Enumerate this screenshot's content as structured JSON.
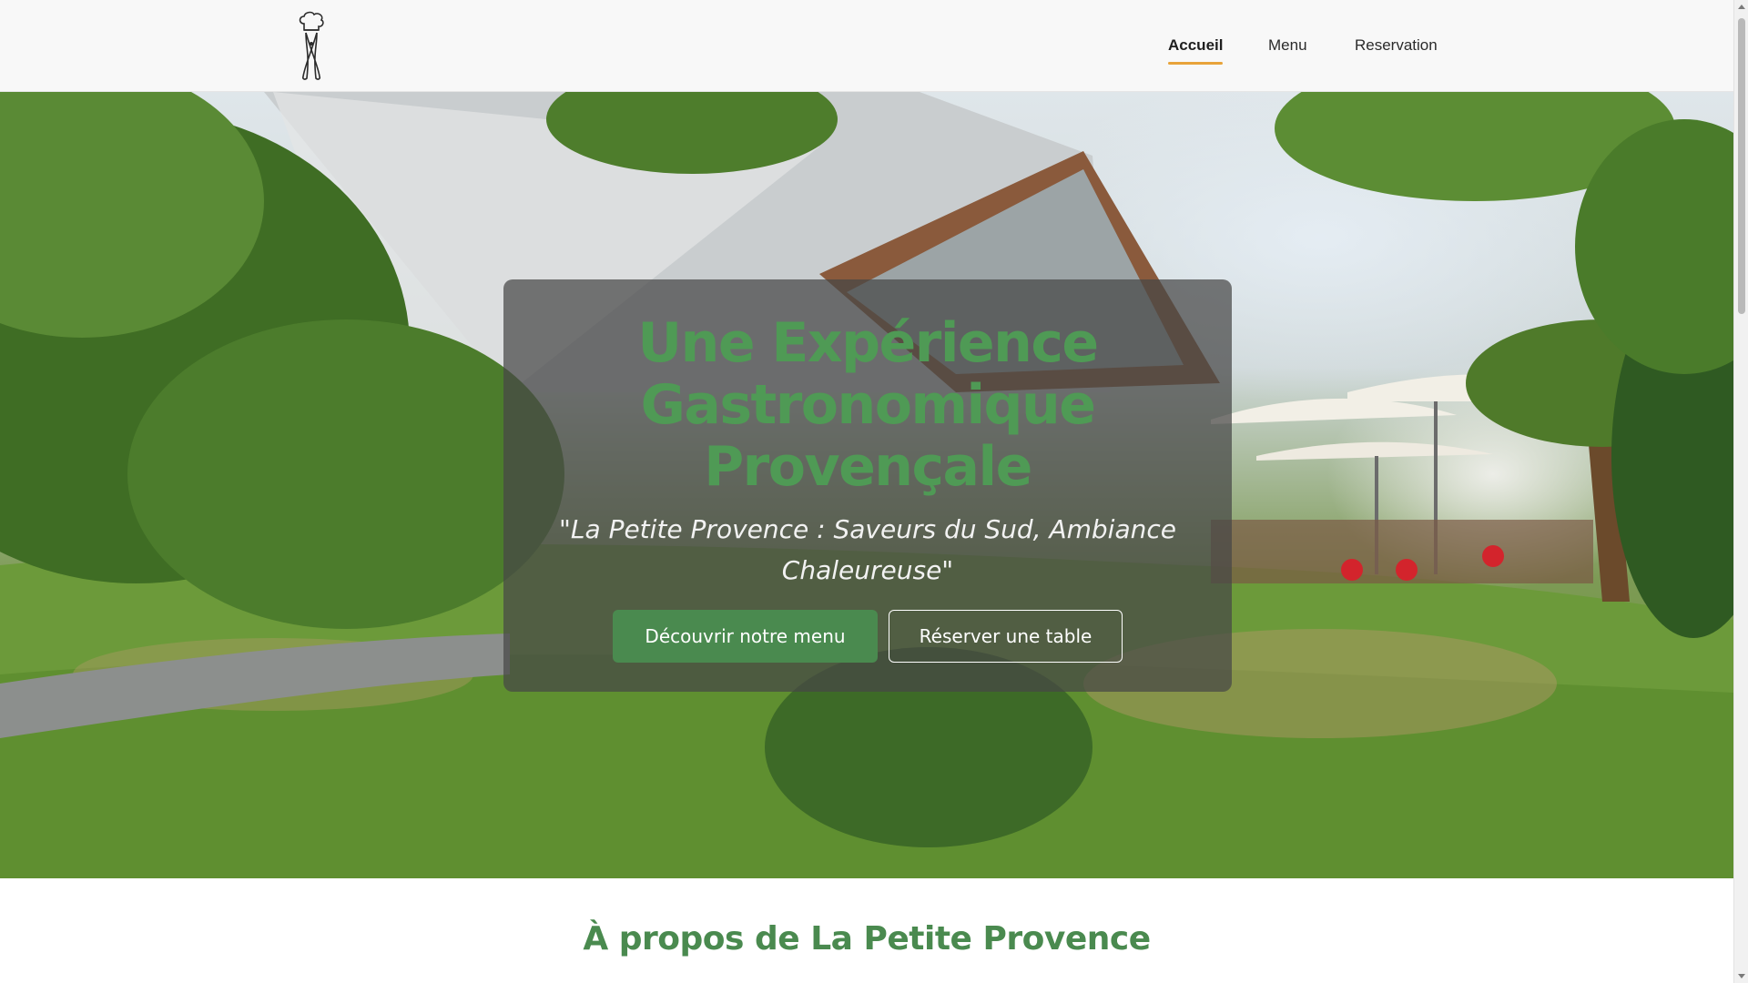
{
  "header": {
    "logo_icon": "chef-hat-utensils-icon",
    "nav": [
      {
        "label": "Accueil",
        "active": true
      },
      {
        "label": "Menu",
        "active": false
      },
      {
        "label": "Reservation",
        "active": false
      }
    ]
  },
  "hero": {
    "title_lines": [
      "Une Expérience",
      "Gastronomique",
      "Provençale"
    ],
    "subtitle": "\"La Petite Provence : Saveurs du Sud, Ambiance Chaleureuse\"",
    "primary_button": "Découvrir notre menu",
    "secondary_button": "Réserver une table"
  },
  "about": {
    "title": "À propos de La Petite Provence"
  },
  "colors": {
    "brand_green": "#4a8a4f",
    "accent_orange": "#e8a33a",
    "header_bg": "#f8f8f8"
  }
}
